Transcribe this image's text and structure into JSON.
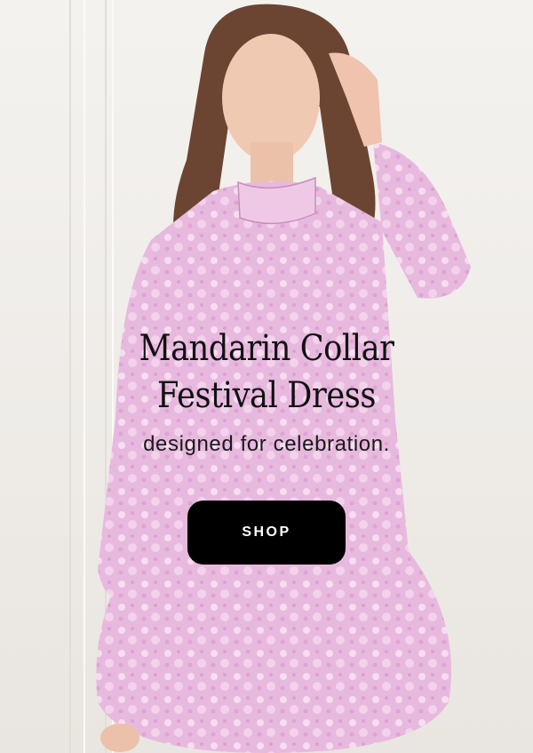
{
  "hero": {
    "headline_line1": "Mandarin Collar",
    "headline_line2": "Festival Dress",
    "tagline": "designed for celebration.",
    "cta_label": "SHOP"
  },
  "colors": {
    "background": "#f1eeeb",
    "dress_pink": "#e7b8dd",
    "button_bg": "#000000",
    "button_text": "#ffffff",
    "text_dark": "#111111"
  }
}
